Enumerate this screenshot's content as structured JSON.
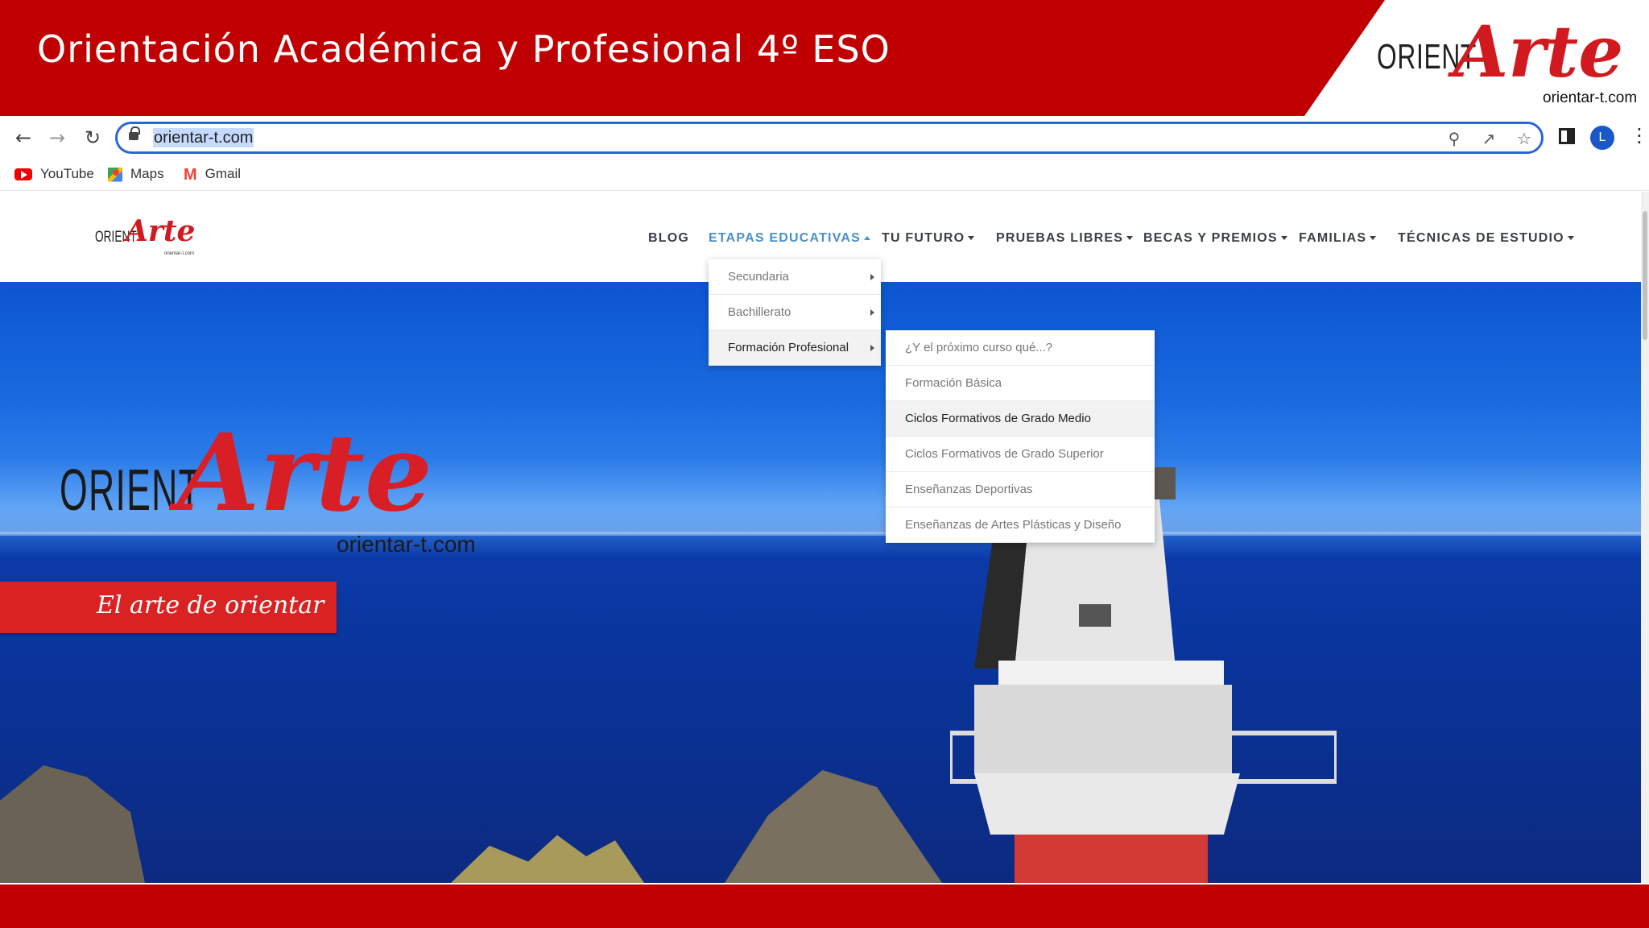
{
  "slide": {
    "title": "Orientación Académica y Profesional 4º ESO",
    "logo": {
      "orient": "ORIENT",
      "arte": "Arte",
      "url": "orientar-t.com"
    },
    "colors": {
      "band": "#c00000",
      "accent": "#d11a1f"
    }
  },
  "browser": {
    "url": "orientar-t.com",
    "profile_initial": "L",
    "bookmarks": [
      {
        "label": "YouTube",
        "icon": "youtube-icon"
      },
      {
        "label": "Maps",
        "icon": "maps-icon"
      },
      {
        "label": "Gmail",
        "icon": "gmail-icon"
      }
    ]
  },
  "site": {
    "logo": {
      "orient": "ORIENT",
      "arte": "Arte",
      "url": "orientar-t.com"
    },
    "nav": [
      {
        "label": "BLOG",
        "caret": false,
        "active": false
      },
      {
        "label": "ETAPAS EDUCATIVAS",
        "caret": true,
        "active": true
      },
      {
        "label": "TU FUTURO",
        "caret": true,
        "active": false
      },
      {
        "label": "PRUEBAS LIBRES",
        "caret": true,
        "active": false
      },
      {
        "label": "BECAS Y PREMIOS",
        "caret": true,
        "active": false
      },
      {
        "label": "FAMILIAS",
        "caret": true,
        "active": false
      },
      {
        "label": "TÉCNICAS DE ESTUDIO",
        "caret": true,
        "active": false
      }
    ],
    "etapas_menu": [
      {
        "label": "Secundaria",
        "submenu": true,
        "hover": false
      },
      {
        "label": "Bachillerato",
        "submenu": true,
        "hover": false
      },
      {
        "label": "Formación Profesional",
        "submenu": true,
        "hover": true
      }
    ],
    "fp_submenu": [
      {
        "label": "¿Y el próximo curso qué...?",
        "hover": false
      },
      {
        "label": "Formación Básica",
        "hover": false
      },
      {
        "label": "Ciclos Formativos de Grado Medio",
        "hover": true
      },
      {
        "label": "Ciclos Formativos de Grado Superior",
        "hover": false
      },
      {
        "label": "Enseñanzas Deportivas",
        "hover": false
      },
      {
        "label": "Enseñanzas de Artes Plásticas y Diseño",
        "hover": false
      }
    ],
    "hero": {
      "logo": {
        "orient": "ORIENT",
        "arte": "Arte",
        "url": "orientar-t.com"
      },
      "tagline": "El arte de orientar"
    }
  }
}
